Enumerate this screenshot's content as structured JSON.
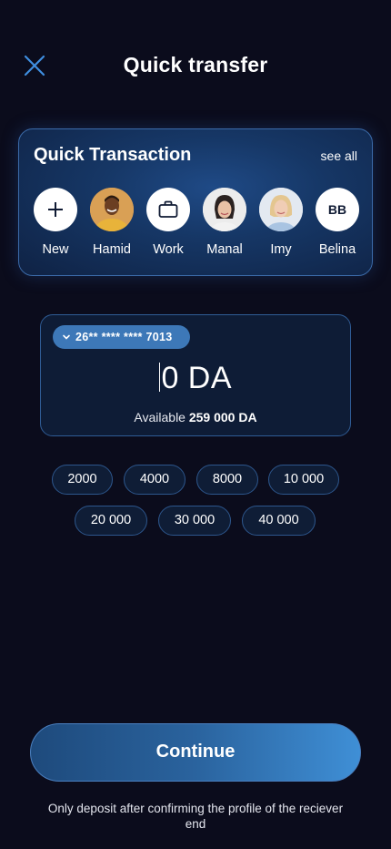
{
  "header": {
    "title": "Quick transfer"
  },
  "quick_transaction": {
    "title": "Quick Transaction",
    "see_all": "see all",
    "contacts": [
      {
        "label": "New",
        "type": "add"
      },
      {
        "label": "Hamid",
        "type": "photo"
      },
      {
        "label": "Work",
        "type": "briefcase"
      },
      {
        "label": "Manal",
        "type": "photo"
      },
      {
        "label": "Imy",
        "type": "photo"
      },
      {
        "label": "Belina",
        "type": "initials",
        "initials": "BB"
      }
    ]
  },
  "amount_card": {
    "card_number": "26** **** **** 7013",
    "amount": "0 DA",
    "available_label": "Available",
    "available_value": "259 000 DA"
  },
  "presets": [
    "2000",
    "4000",
    "8000",
    "10 000",
    "20 000",
    "30 000",
    "40 000"
  ],
  "continue_label": "Continue",
  "footer_note": "Only deposit after confirming the profile of the reciever end",
  "colors": {
    "background": "#0b0c1c",
    "accent": "#3d78b8"
  }
}
